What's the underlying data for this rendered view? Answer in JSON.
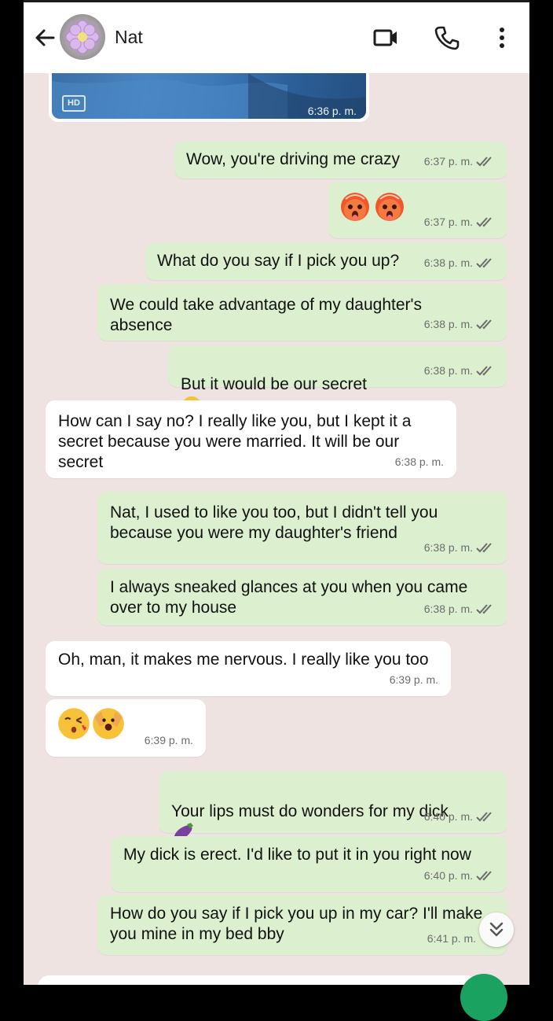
{
  "header": {
    "contact_name": "Nat",
    "icons": [
      "back-arrow-icon",
      "video-call-icon",
      "phone-icon",
      "more-options-icon"
    ]
  },
  "media_message": {
    "badge": "HD",
    "time": "6:36 p. m."
  },
  "messages": [
    {
      "dir": "out",
      "text": "Wow, you're driving me crazy",
      "time": "6:37 p. m."
    },
    {
      "dir": "out",
      "text": "",
      "emoji": [
        "hot-face-emoji",
        "hot-face-emoji"
      ],
      "time": "6:37 p. m."
    },
    {
      "dir": "out",
      "text": "What do you say if I pick you up?",
      "time": "6:38 p. m."
    },
    {
      "dir": "out",
      "text": "We could take advantage of my daughter's\nabsence",
      "time": "6:38 p. m."
    },
    {
      "dir": "out",
      "text": "But it would be our secret",
      "emoji": [
        "shushing-face-emoji"
      ],
      "time": "6:38 p. m."
    },
    {
      "dir": "in",
      "text": "How can I say no? I really like you, but I kept it a\nsecret because you were married. It will be our\nsecret",
      "time": "6:38 p. m."
    },
    {
      "dir": "out",
      "text": "Nat, I used to like you too, but I didn't tell you\nbecause you were my daughter's friend",
      "time": "6:38 p. m."
    },
    {
      "dir": "out",
      "text": "I always sneaked glances at you when you came\nover to my house",
      "time": "6:38 p. m."
    },
    {
      "dir": "in",
      "text": "Oh, man, it makes me nervous. I really like you too",
      "time": "6:39 p. m."
    },
    {
      "dir": "in",
      "text": "",
      "emoji": [
        "kissing-face-emoji",
        "peeking-face-emoji"
      ],
      "time": "6:39 p. m."
    },
    {
      "dir": "out",
      "text": "Your lips must do wonders for my dick",
      "emoji": [
        "eggplant-emoji"
      ],
      "time": "6:40 p. m."
    },
    {
      "dir": "out",
      "text": "My dick is erect. I'd like to put it in you right now",
      "time": "6:40 p. m."
    },
    {
      "dir": "out",
      "text": "How do you say if I pick you up in my car? I'll make\nyou mine in my bed bby",
      "time": "6:41 p. m."
    }
  ],
  "colors": {
    "outgoing_bubble": "#dcf0cf",
    "incoming_bubble": "#ffffff",
    "chat_background": "#efe3e1",
    "read_ticks": "#6c6c6c"
  }
}
